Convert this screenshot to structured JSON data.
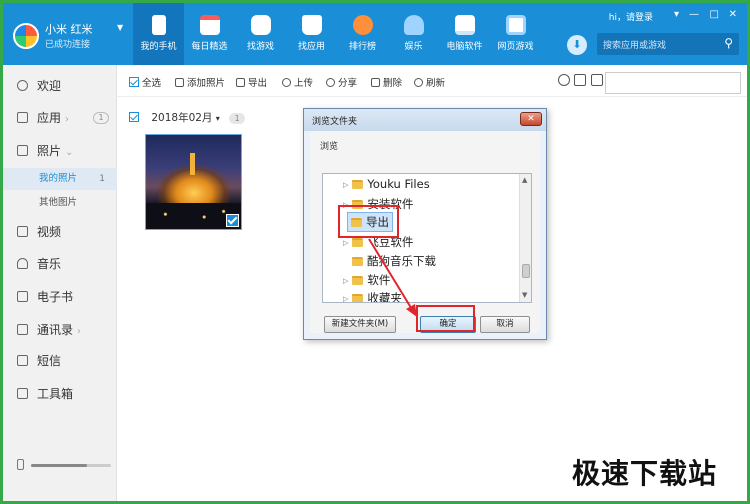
{
  "header": {
    "device_name": "小米 红米",
    "device_status": "已成功连接",
    "login_text": "hi，请登录",
    "search_placeholder": "搜索应用或游戏",
    "tabs": [
      {
        "label": "我的手机",
        "icon": "phone-icon"
      },
      {
        "label": "每日精选",
        "icon": "calendar-icon"
      },
      {
        "label": "找游戏",
        "icon": "gamepad-icon"
      },
      {
        "label": "找应用",
        "icon": "shopping-bag-icon"
      },
      {
        "label": "排行榜",
        "icon": "rank-icon"
      },
      {
        "label": "娱乐",
        "icon": "entertainment-icon"
      },
      {
        "label": "电脑软件",
        "icon": "monitor-icon"
      },
      {
        "label": "网页游戏",
        "icon": "web-game-icon"
      }
    ],
    "window_controls": [
      "▾",
      "—",
      "□",
      "✕"
    ]
  },
  "sidebar": {
    "items": [
      {
        "label": "欢迎"
      },
      {
        "label": "应用",
        "badge": "1"
      },
      {
        "label": "照片"
      },
      {
        "label": "视频"
      },
      {
        "label": "音乐"
      },
      {
        "label": "电子书"
      },
      {
        "label": "通讯录"
      },
      {
        "label": "短信"
      },
      {
        "label": "工具箱"
      }
    ],
    "sub_items": [
      {
        "label": "我的照片",
        "count": "1"
      },
      {
        "label": "其他图片"
      }
    ],
    "storage_fraction": 0.7
  },
  "toolbar": {
    "select_all": "全选",
    "add_photo": "添加照片",
    "export": "导出",
    "upload": "上传",
    "share": "分享",
    "delete": "删除",
    "refresh": "刷新"
  },
  "content": {
    "group_date": "2018年02月",
    "group_count": "1"
  },
  "dialog": {
    "title": "浏览文件夹",
    "label": "浏览",
    "tree": [
      {
        "label": "Youku Files",
        "expandable": true
      },
      {
        "label": "安装软件",
        "expandable": true
      },
      {
        "label": "导出",
        "expandable": false,
        "selected": true
      },
      {
        "label": "飞豆软件",
        "expandable": true
      },
      {
        "label": "酷狗音乐下载",
        "expandable": false
      },
      {
        "label": "软件",
        "expandable": true
      },
      {
        "label": "收藏夹",
        "expandable": true
      }
    ],
    "new_folder_btn": "新建文件夹(M)",
    "ok_btn": "确定",
    "cancel_btn": "取消",
    "close_glyph": "✕"
  },
  "colors": {
    "accent": "#1a8fd8",
    "frame": "#35a848",
    "highlight": "#e0262a"
  },
  "watermark": "极速下载站"
}
